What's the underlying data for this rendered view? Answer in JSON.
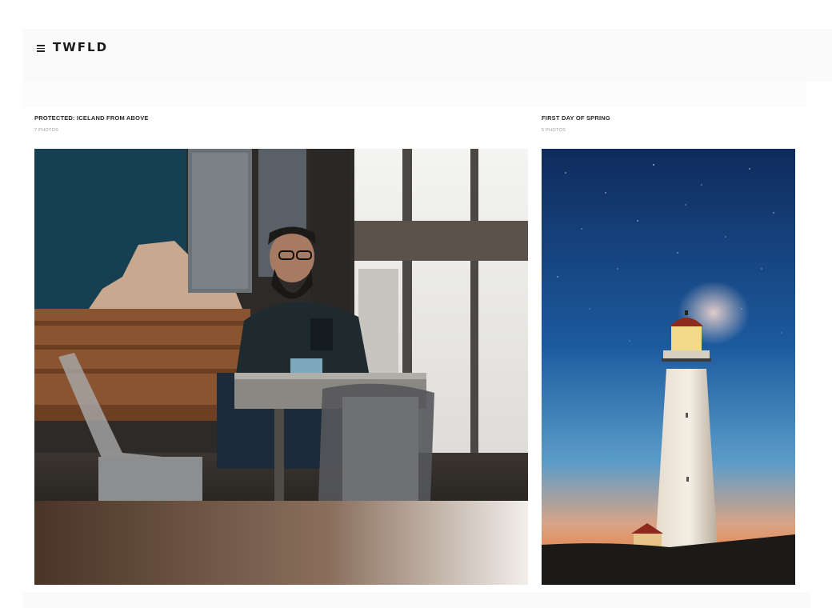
{
  "header": {
    "menu_icon": "hamburger-menu-icon",
    "logo": "TWFLD"
  },
  "galleries": [
    {
      "title": "PROTECTED: ICELAND FROM ABOVE",
      "count": "7 PHOTOS"
    },
    {
      "title": "FIRST DAY OF SPRING",
      "count": "5 PHOTOS"
    }
  ],
  "colors": {
    "header_bg": "#fafafa",
    "text": "#1a1a1a",
    "muted": "#999999"
  }
}
